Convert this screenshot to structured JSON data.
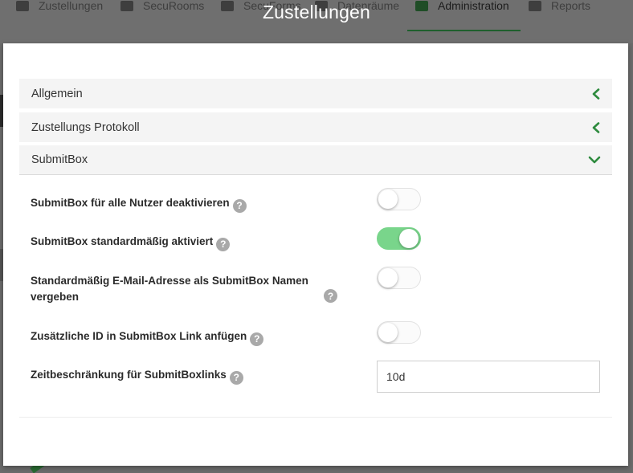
{
  "background_nav": {
    "tabs": [
      {
        "label": "Zustellungen"
      },
      {
        "label": "SecuRooms"
      },
      {
        "label": "SecuForms"
      },
      {
        "label": "Datenräume"
      },
      {
        "label": "Administration"
      },
      {
        "label": "Reports"
      }
    ]
  },
  "modal": {
    "title": "Zustellungen",
    "sections": [
      {
        "label": "Allgemein",
        "expanded": false
      },
      {
        "label": "Zustellungs Protokoll",
        "expanded": false
      },
      {
        "label": "SubmitBox",
        "expanded": true
      }
    ],
    "settings": [
      {
        "label": "SubmitBox für alle Nutzer deaktivieren",
        "type": "toggle",
        "value": false
      },
      {
        "label": "SubmitBox standardmäßig aktiviert",
        "type": "toggle",
        "value": true
      },
      {
        "label_line1": "Standardmäßig E-Mail-Adresse als SubmitBox Namen",
        "label_line2": "vergeben",
        "type": "toggle",
        "value": false
      },
      {
        "label": "Zusätzliche ID in SubmitBox Link anfügen",
        "type": "toggle",
        "value": false
      },
      {
        "label": "Zeitbeschränkung für SubmitBoxlinks",
        "type": "text",
        "value": "10d"
      }
    ],
    "help_glyph": "?"
  },
  "colors": {
    "accent_green": "#2e8b3e",
    "toggle_on": "#79d58b",
    "overlay": "#6b6b6b"
  },
  "icons": [
    "chevron-left-icon",
    "chevron-down-icon",
    "help-icon"
  ]
}
